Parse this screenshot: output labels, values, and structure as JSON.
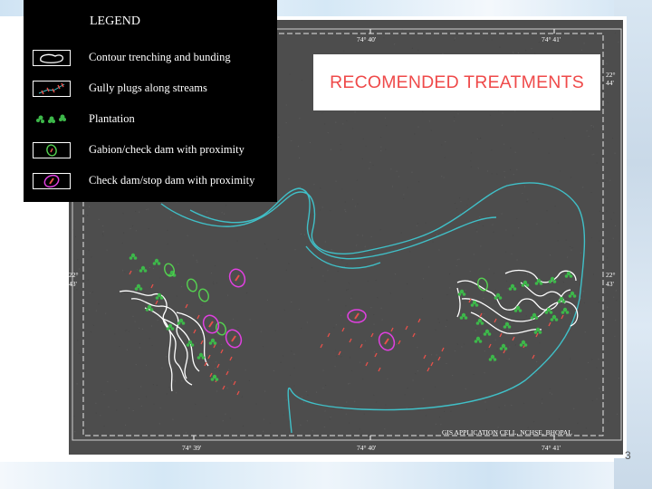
{
  "map": {
    "title": "RECOMENDED TREATMENTS",
    "credit": "GIS APPLICATION CELL, NCHSE, BHOPAL",
    "coordinates": {
      "top_long_1": "74° 40'",
      "top_long_2": "74° 41'",
      "bottom_long_1": "74° 39'",
      "bottom_long_2": "74° 40'",
      "bottom_long_3": "74° 41'",
      "left_lat_deg": "22°",
      "left_lat_min": "43'",
      "right_lat_deg_top": "22°",
      "right_lat_min_top": "44'",
      "right_lat_deg_mid": "22°",
      "right_lat_min_mid": "43'"
    },
    "colors": {
      "background": "#4d4d4d",
      "stream": "#40c0c8",
      "contour": "#ffffff",
      "gully_plug": "#e8504a",
      "plantation": "#3db84a",
      "gabion": "#55d050",
      "check_dam": "#e040e0"
    }
  },
  "legend": {
    "title": "LEGEND",
    "items": [
      {
        "label": "Contour trenching and bunding",
        "icon": "contour-icon"
      },
      {
        "label": "Gully plugs along streams",
        "icon": "gully-plug-icon"
      },
      {
        "label": "Plantation",
        "icon": "plantation-icon"
      },
      {
        "label": "Gabion/check dam with proximity",
        "icon": "gabion-icon"
      },
      {
        "label": "Check dam/stop dam with proximity",
        "icon": "check-dam-icon"
      }
    ]
  },
  "slide": {
    "page_number": "3"
  }
}
